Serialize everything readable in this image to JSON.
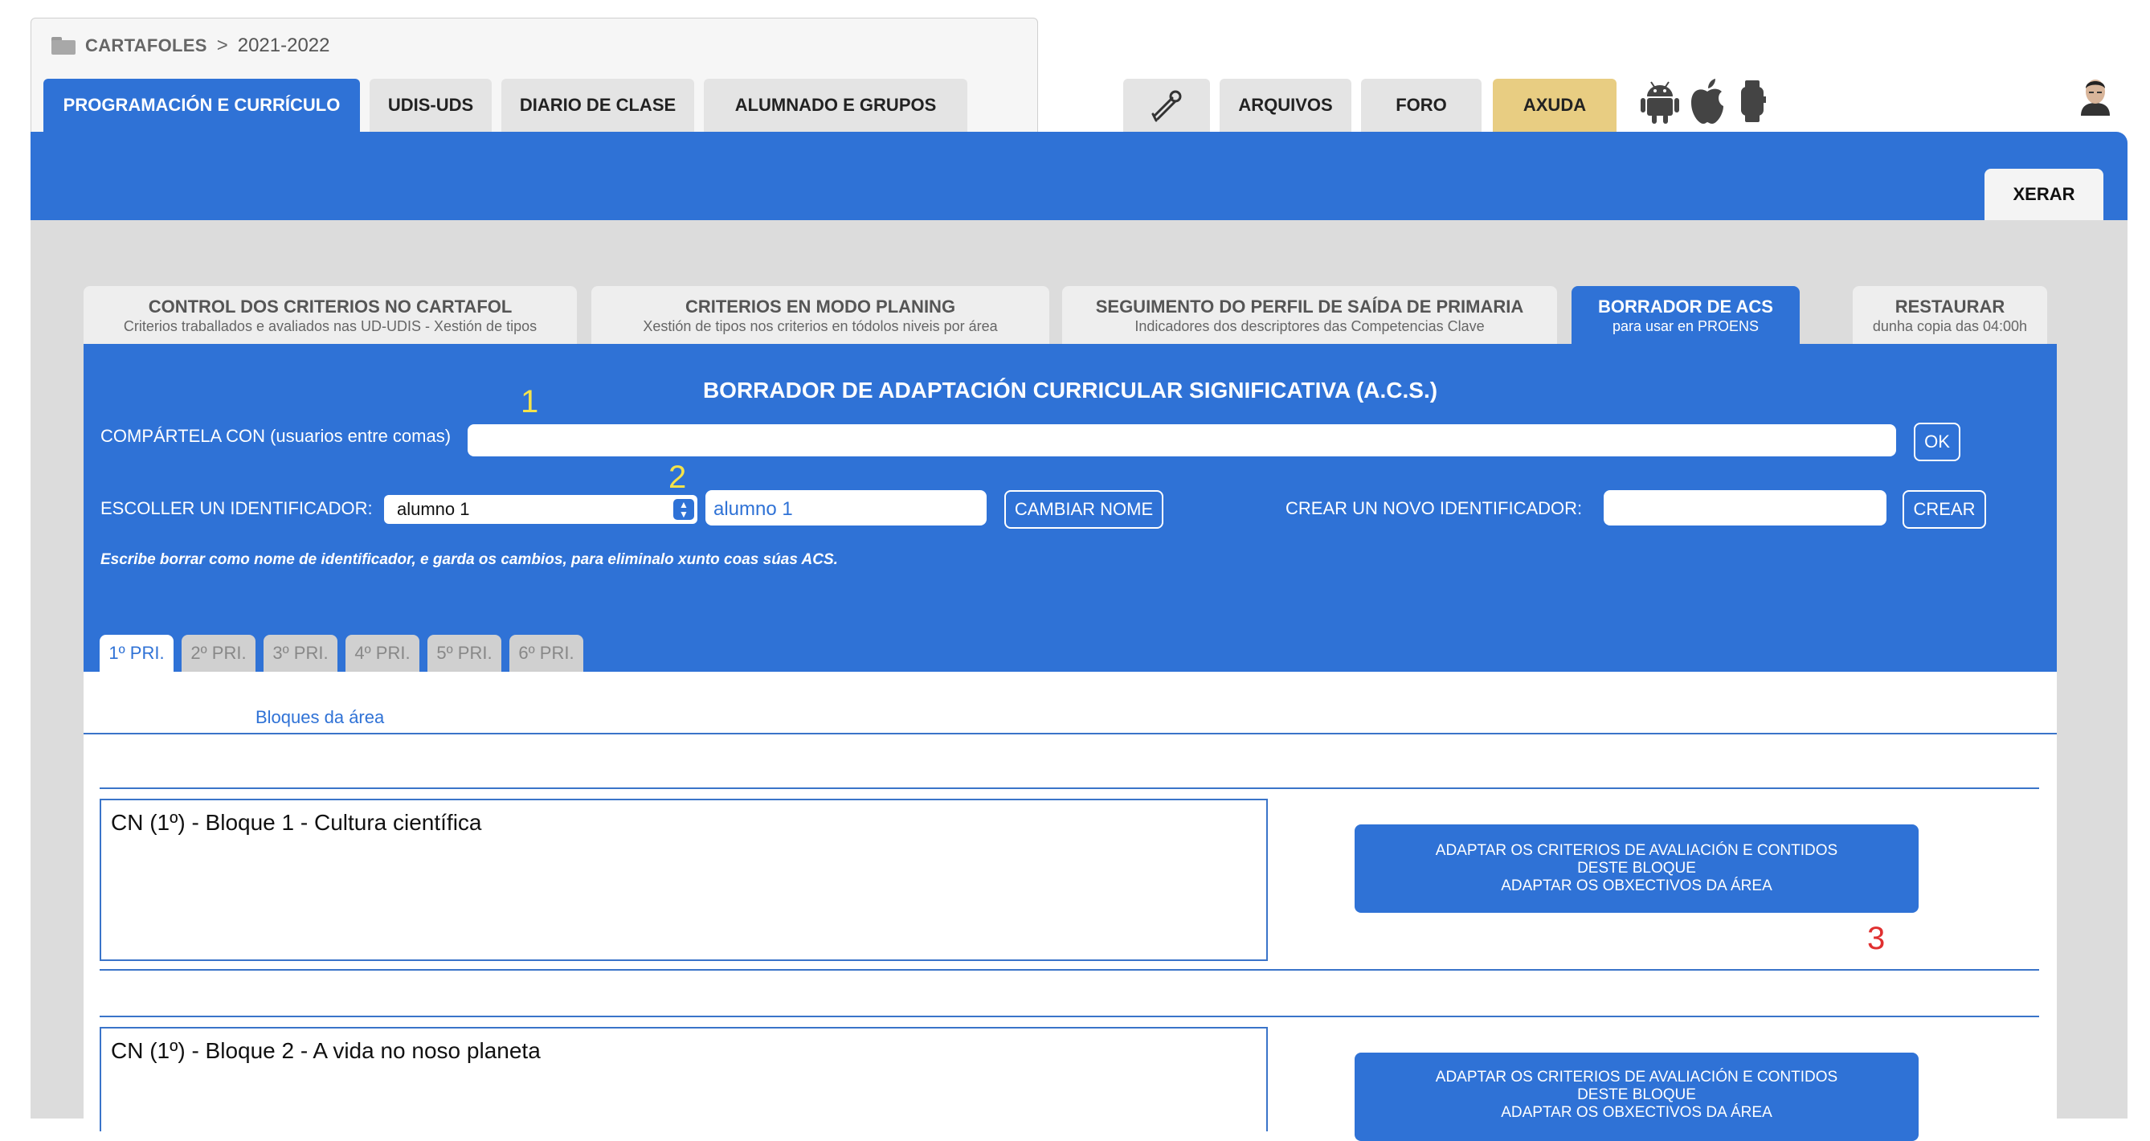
{
  "breadcrumb": {
    "root": "CARTAFOLES",
    "separator": ">",
    "year": "2021-2022"
  },
  "main_tabs": [
    {
      "label": "PROGRAMACIÓN E CURRÍCULO",
      "active": true
    },
    {
      "label": "UDIS-UDS"
    },
    {
      "label": "DIARIO DE CLASE"
    },
    {
      "label": "ALUMNADO E GRUPOS"
    }
  ],
  "tools": {
    "wrench_icon": "wrench-icon",
    "arquivos": "ARQUIVOS",
    "foro": "FORO",
    "axuda": "AXUDA",
    "platform_icons": [
      "android-icon",
      "apple-icon",
      "watch-icon"
    ],
    "avatar": "user-avatar"
  },
  "banner": {
    "xerar": "XERAR"
  },
  "sub_tabs": [
    {
      "title": "CONTROL DOS CRITERIOS NO CARTAFOL",
      "subtitle": "Criterios traballados e avaliados nas UD-UDIS - Xestión de tipos"
    },
    {
      "title": "CRITERIOS EN MODO PLANING",
      "subtitle": "Xestión de tipos nos criterios en tódolos niveis por área"
    },
    {
      "title": "SEGUIMENTO DO PERFIL DE SAÍDA DE PRIMARIA",
      "subtitle": "Indicadores dos descriptores das Competencias Clave"
    },
    {
      "title": "BORRADOR DE ACS",
      "subtitle": "para usar en PROENS",
      "active": true
    },
    {
      "title": "RESTAURAR",
      "subtitle": "dunha copia das 04:00h"
    }
  ],
  "panel": {
    "title": "BORRADOR DE ADAPTACIÓN CURRICULAR SIGNIFICATIVA (A.C.S.)",
    "share_label": "COMPÁRTELA CON (usuarios entre comas)",
    "share_value": "",
    "ok": "OK",
    "choose_label": "ESCOLLER UN IDENTIFICADOR:",
    "choose_selected": "alumno 1",
    "rename_value": "alumno 1",
    "rename_button": "CAMBIAR NOME",
    "create_label": "CREAR UN NOVO IDENTIFICADOR:",
    "create_value": "",
    "create_button": "CREAR",
    "note": "Escribe borrar como nome de identificador, e garda os cambios, para eliminalo xunto coas súas ACS."
  },
  "markers": {
    "m1": "1",
    "m2": "2",
    "m3": "3"
  },
  "year_tabs": [
    "1º PRI.",
    "2º PRI.",
    "3º PRI.",
    "4º PRI.",
    "5º PRI.",
    "6º PRI."
  ],
  "area": {
    "blocks_label": "Bloques da área"
  },
  "blocks": [
    {
      "title": "CN (1º) - Bloque 1 - Cultura científica",
      "button_lines": [
        "ADAPTAR OS CRITERIOS DE AVALIACIÓN E CONTIDOS",
        "DESTE BLOQUE",
        "ADAPTAR OS OBXECTIVOS DA ÁREA"
      ]
    },
    {
      "title": "CN (1º) - Bloque 2 - A vida no noso planeta",
      "button_lines": [
        "ADAPTAR OS CRITERIOS DE AVALIACIÓN E CONTIDOS",
        "DESTE BLOQUE",
        "ADAPTAR OS OBXECTIVOS DA ÁREA"
      ]
    }
  ]
}
